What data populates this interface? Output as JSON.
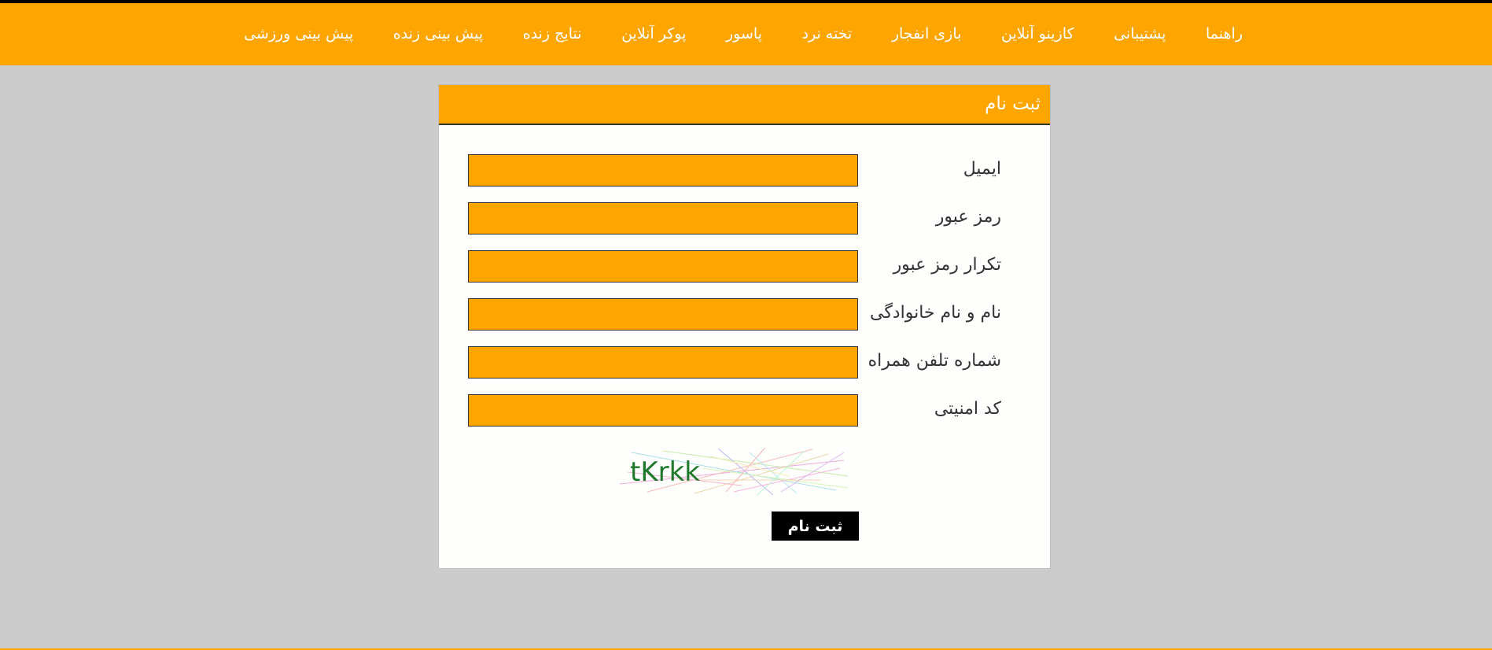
{
  "nav": {
    "items": [
      "پیش بینی ورزشی",
      "پیش بینی زنده",
      "نتایج زنده",
      "پوکر آنلاین",
      "پاسور",
      "تخته نرد",
      "بازی انفجار",
      "کازینو آنلاین",
      "پشتیبانی",
      "راهنما"
    ]
  },
  "form": {
    "title": "ثبت نام",
    "fields": [
      {
        "label": "ایمیل",
        "value": ""
      },
      {
        "label": "رمز عبور",
        "value": ""
      },
      {
        "label": "تکرار رمز عبور",
        "value": ""
      },
      {
        "label": "نام و نام خانوادگی",
        "value": ""
      },
      {
        "label": "شماره تلفن همراه",
        "value": ""
      },
      {
        "label": "کد امنیتی",
        "value": ""
      }
    ],
    "captcha_text": "tKrkk",
    "submit_label": "ثبت نام"
  },
  "colors": {
    "accent": "#ffa500",
    "background": "#cccccc",
    "button": "#000000",
    "captcha_text": "#1e7a2a"
  }
}
